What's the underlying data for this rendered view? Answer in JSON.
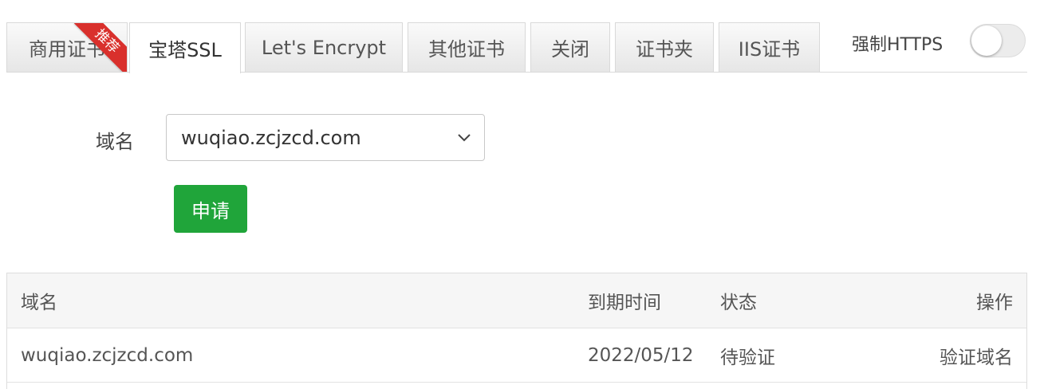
{
  "tabs": [
    {
      "label": "商用证书",
      "badge": "推荐",
      "active": false
    },
    {
      "label": "宝塔SSL",
      "active": true
    },
    {
      "label": "Let's Encrypt",
      "active": false
    },
    {
      "label": "其他证书",
      "active": false
    },
    {
      "label": "关闭",
      "active": false
    },
    {
      "label": "证书夹",
      "active": false
    },
    {
      "label": "IIS证书",
      "active": false
    }
  ],
  "force_https": {
    "label": "强制HTTPS",
    "enabled": false
  },
  "form": {
    "domain_label": "域名",
    "domain_selected": "wuqiao.zcjzcd.com",
    "apply_label": "申请"
  },
  "table": {
    "headers": {
      "domain": "域名",
      "expire": "到期时间",
      "status": "状态",
      "action": "操作"
    },
    "rows": [
      {
        "domain": "wuqiao.zcjzcd.com",
        "expire": "2022/05/12",
        "status": "待验证",
        "action": "验证域名"
      }
    ]
  },
  "colors": {
    "accent": "#20a53a",
    "ribbon": "#d9302c"
  }
}
